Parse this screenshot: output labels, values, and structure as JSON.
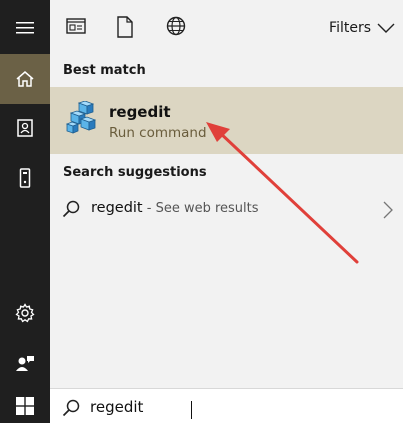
{
  "toolbar": {
    "filters_label": "Filters"
  },
  "sections": {
    "best_match": "Best match",
    "search_suggestions": "Search suggestions"
  },
  "best_match_item": {
    "title": "regedit",
    "subtitle": "Run command"
  },
  "suggestion": {
    "query": "regedit",
    "secondary": " - See web results"
  },
  "search": {
    "value": "regedit"
  },
  "colors": {
    "rail_bg": "#1f1f1f",
    "rail_active": "#6b6146",
    "highlight": "#dcd6c2",
    "annotation_arrow": "#e0403a"
  },
  "icons": {
    "menu": "hamburger-icon",
    "home": "home-icon",
    "documents": "document-book-icon",
    "devices": "tower-icon",
    "settings": "gear-icon",
    "feedback": "person-feedback-icon",
    "start": "windows-logo-icon",
    "apps": "app-window-icon",
    "docs": "document-icon",
    "web": "globe-icon",
    "search": "search-icon",
    "chevron": "chevron-right-icon",
    "filters_chevron": "chevron-down-icon"
  }
}
